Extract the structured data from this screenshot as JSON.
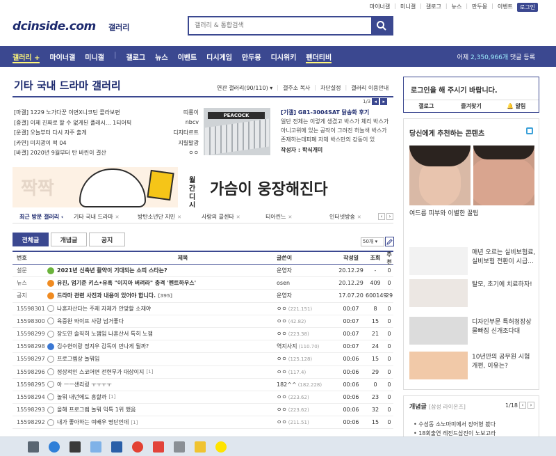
{
  "util": [
    "마이너갤",
    "미니갤",
    "갤로그",
    "뉴스",
    "만두몽",
    "이벤트"
  ],
  "util_login": "로그인",
  "logo": {
    "main": "dcinside.com",
    "sub": "갤러리"
  },
  "search": {
    "placeholder": "갤러리 & 통합검색"
  },
  "nav": {
    "items": [
      "갤러리 +",
      "마이너갤",
      "미니갤",
      "갤로그",
      "뉴스",
      "이벤트",
      "디시게임",
      "만두몽",
      "디시위키",
      "펜더티비"
    ],
    "right_prefix": "어제",
    "right_count": "2,350,966개",
    "right_suffix": "댓글 등록"
  },
  "gallery": {
    "title": "기타 국내 드라마 갤러리",
    "menu": [
      "연관 갤러리(90/110) ▾",
      "갤주소 복사",
      "차단설정",
      "갤러리 이용안내"
    ]
  },
  "hot": [
    {
      "title": "[마갤] 1229 노가다꾼 이면X니코틴 콜라보편",
      "user": "띠롱이"
    },
    {
      "title": "[중갤] 이제 진짜로 할 수 없게된 플레시... 1티어픽",
      "user": "nbcv"
    },
    {
      "title": "[운갤] 오늘부터 다시 자주 출게",
      "user": "디지타르트"
    },
    {
      "title": "[카연] 미치광이 퍽 04",
      "user": "지릴발광"
    },
    {
      "title": "[바갤] 2020년 9월부터 탄 바린이 결산",
      "user": "ㅇㅇ"
    }
  ],
  "hot_side": {
    "head": "[기갤] G81-3004SAT 닭송화 후기",
    "body": "일단 전체는 이렇게 생겼고 박스가 체리 박스가 아니고위에 있는 공작이 그려진 허늘색 박스가 존재하는데피폐 자체 박스만의 강동이 있",
    "writer": "작성자 : 학식개미",
    "thumb_label": "PEACOCK",
    "page": "1/3"
  },
  "banner": {
    "big": "짝짝",
    "small": "월간 디시",
    "main": "가슴이 웅장해진다"
  },
  "recent": {
    "label": "최근 방문 갤러리 ‹",
    "items": [
      "기타 국내 드라마",
      "방탄소년단 지민",
      "사랑의 콜센타",
      "티아린느",
      "인터넷방송"
    ]
  },
  "tabs": [
    "전체글",
    "개념글",
    "공지"
  ],
  "perpage": "50개 ▾",
  "table_head": {
    "no": "번호",
    "title": "제목",
    "writer": "글쓴이",
    "date": "작성일",
    "view": "조회",
    "rec": "추천"
  },
  "rows": [
    {
      "no": "설문",
      "icon": "green",
      "title": "2021년 신축년 활약이 기대되는 소띠 스타는?",
      "cmt": "",
      "writer": "운영자",
      "ip": "",
      "date": "20.12.29",
      "view": "-",
      "rec": "0",
      "notice": true
    },
    {
      "no": "뉴스",
      "icon": "orange",
      "title": "유진, 엄기준 키스•유혹 \"이지아 버려라\" 충격 '펜트하우스'",
      "cmt": "",
      "writer": "osen",
      "ip": "",
      "date": "20.12.29",
      "view": "409",
      "rec": "0",
      "notice": true
    },
    {
      "no": "공지",
      "icon": "orange",
      "title": "드라마 관련 사진과 내용이 있어야 합니다.",
      "cmt": "[395]",
      "writer": "운영자",
      "ip": "",
      "date": "17.07.20",
      "view": "600149",
      "rec": "29",
      "notice": true
    },
    {
      "no": "15598301",
      "icon": "gray",
      "title": "나혼자산다는 주제 자체가 안맞할 소재야",
      "cmt": "",
      "writer": "ㅇㅇ",
      "ip": "(221.151)",
      "date": "00:07",
      "view": "8",
      "rec": "0",
      "notice": false
    },
    {
      "no": "15598300",
      "icon": "gray",
      "title": "육중완 와이프 사랑 넘거좋다",
      "cmt": "",
      "writer": "ㅇㅇ",
      "ip": "(42.82)",
      "date": "00:07",
      "view": "15",
      "rec": "0",
      "notice": false
    },
    {
      "no": "15598299",
      "icon": "gray",
      "title": "장도연 솔직히 노잼임 나혼산서 특히 노잼",
      "cmt": "",
      "writer": "ㅇㅇ",
      "ip": "(223.38)",
      "date": "00:07",
      "view": "21",
      "rec": "0",
      "notice": false
    },
    {
      "no": "15598298",
      "icon": "blue",
      "title": "김수현이랑 정지우 감독이 만나게 될까?",
      "cmt": "",
      "writer": "역지사지",
      "ip": "(110.70)",
      "date": "00:07",
      "view": "24",
      "rec": "0",
      "notice": false
    },
    {
      "no": "15598297",
      "icon": "gray",
      "title": "프로그렘상 놀뭐임",
      "cmt": "",
      "writer": "ㅇㅇ",
      "ip": "(125.128)",
      "date": "00:06",
      "view": "15",
      "rec": "0",
      "notice": false
    },
    {
      "no": "15598296",
      "icon": "gray",
      "title": "정상적인 스코어면 전현무가 대상이지",
      "cmt": "[1]",
      "writer": "ㅇㅇ",
      "ip": "(117.4)",
      "date": "00:06",
      "view": "29",
      "rec": "0",
      "notice": false
    },
    {
      "no": "15598295",
      "icon": "gray",
      "title": "아 ㅡㅡ샌리링 ㅜㅜㅜㅜ",
      "cmt": "",
      "writer": "182^^",
      "ip": "(182.228)",
      "date": "00:06",
      "view": "0",
      "rec": "0",
      "notice": false
    },
    {
      "no": "15598294",
      "icon": "gray",
      "title": "놀뭐 내년에도 흥할까",
      "cmt": "[1]",
      "writer": "ㅇㅇ",
      "ip": "(223.62)",
      "date": "00:06",
      "view": "23",
      "rec": "0",
      "notice": false
    },
    {
      "no": "15598293",
      "icon": "gray",
      "title": "올해 프로그렘 놀뭐 익특 1위 했음",
      "cmt": "",
      "writer": "ㅇㅇ",
      "ip": "(223.62)",
      "date": "00:06",
      "view": "32",
      "rec": "0",
      "notice": false
    },
    {
      "no": "15598292",
      "icon": "gray",
      "title": "내가 좋아하는 여배우 명단인데",
      "cmt": "[1]",
      "writer": "ㅇㅇ",
      "ip": "(211.51)",
      "date": "00:06",
      "view": "15",
      "rec": "0",
      "notice": false
    }
  ],
  "login_box": {
    "msg": "로그인을 해 주시기 바랍니다.",
    "btns": [
      "갤로그",
      "즐겨찾기",
      "🔔 알림"
    ]
  },
  "rec_box": {
    "head": "당신에게 추천하는 콘텐츠",
    "cap1": "여드름 피부와 이별한 꿀팁",
    "items": [
      "매년 오르는 실비보험료, 실비보험 전환이 시급...",
      "탈모, 초기에 치료하자!",
      "디자인부문 특허청장상 물빠짐 신개조다대",
      "10년만의 공무원 시험 개편, 이유는?"
    ]
  },
  "concept": {
    "head": "개념글",
    "sub": "[삼성 라이온즈]",
    "page": "1/18",
    "items": [
      "• 수성동 소노마미에서 장어형 봤다",
      "• 18회출연 레전드삼진이 노보고라"
    ]
  },
  "colors": {
    "primary": "#3b4890",
    "accent": "#fff77a",
    "link": "#1d2a6e"
  }
}
